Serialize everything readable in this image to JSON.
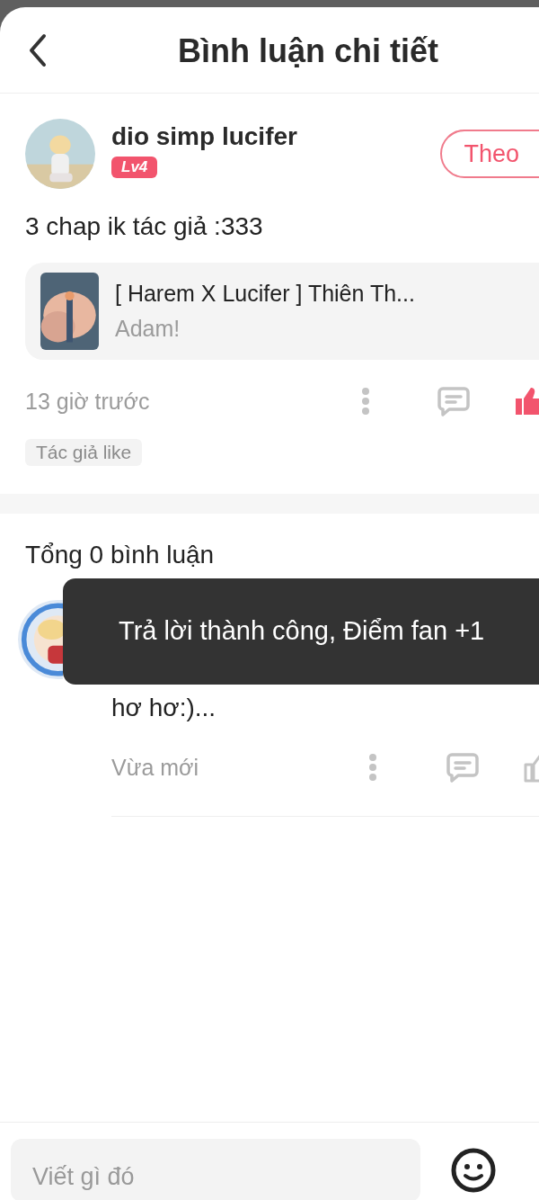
{
  "header": {
    "title": "Bình luận chi tiết"
  },
  "comment": {
    "author": "dio simp lucifer",
    "level": "Lv4",
    "follow_label": "Theo",
    "text": "3 chap ik tác giả :333",
    "book": {
      "title": "[ Harem X Lucifer ] Thiên Th...",
      "author": "Adam!"
    },
    "time": "13 giờ trước",
    "liked": true,
    "tag": "Tác giả like"
  },
  "replies_header": "Tổng 0 bình luận",
  "replies": [
    {
      "text": "hơ hơ:)...",
      "time": "Vừa mới",
      "liked": false
    }
  ],
  "toast": "Trả lời thành công, Điểm fan +1",
  "input": {
    "placeholder": "Viết gì đó"
  }
}
